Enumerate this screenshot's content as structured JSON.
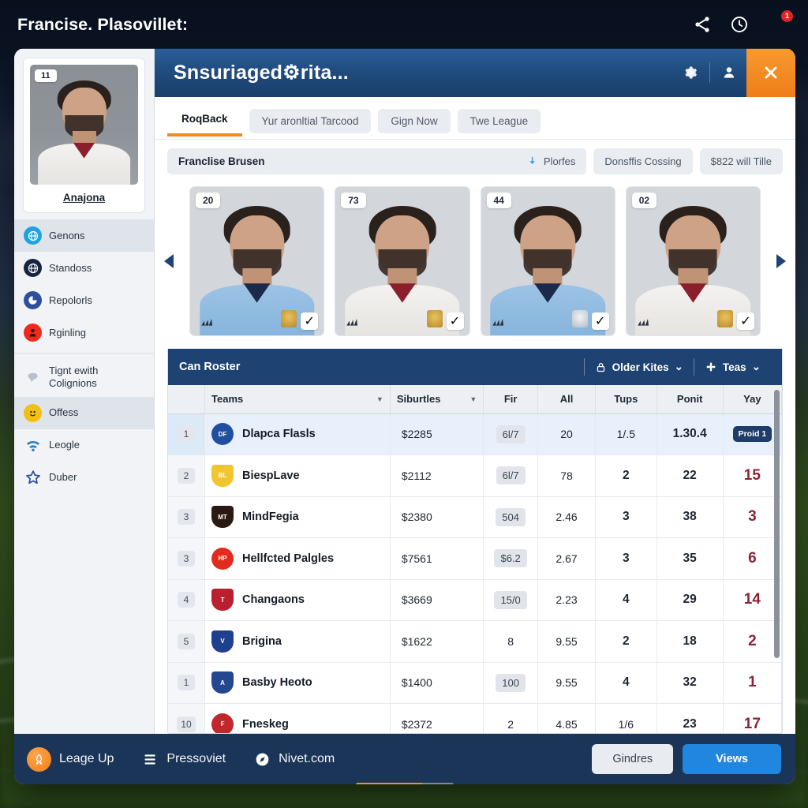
{
  "topbar": {
    "title": "Francise. Plasovillet:",
    "icons": [
      "share-icon",
      "clock-icon"
    ],
    "avatar_badge": "1"
  },
  "window": {
    "title": "Snsuriaged⚙rita...",
    "controls": {
      "settings": "gear-icon",
      "account": "person-icon",
      "close": "✕"
    }
  },
  "sidebar": {
    "profile": {
      "number": "11",
      "name": "Anajona"
    },
    "items": [
      {
        "label": "Genons",
        "icon": "globe-icon",
        "color": "#1ca3e0",
        "active": true
      },
      {
        "label": "Standoss",
        "icon": "globe-icon",
        "color": "#16243f",
        "active": false
      },
      {
        "label": "Repolorls",
        "icon": "pie-icon",
        "color": "#2d4f9e",
        "active": false
      },
      {
        "label": "Rginling",
        "icon": "person-icon",
        "color": "#ef2a1c",
        "active": false
      },
      {
        "label": "Tignt ewith Colignions",
        "icon": "bird-icon",
        "color": "#c7ccd4",
        "active": false
      },
      {
        "label": "Offess",
        "icon": "emoji-icon",
        "color": "#f2c014",
        "active": true
      },
      {
        "label": "Leogle",
        "icon": "wifi-icon",
        "color": "#2d7fc1",
        "active": false
      },
      {
        "label": "Duber",
        "icon": "star-icon",
        "color": "#2d4f9e",
        "active": false
      }
    ]
  },
  "tabs": [
    {
      "label": "RoqBack",
      "active": true
    },
    {
      "label": "Yur aronltial Tarcood",
      "active": false
    },
    {
      "label": "Gign Now",
      "active": false
    },
    {
      "label": "Twe League",
      "active": false
    }
  ],
  "filters": {
    "primary": "Franclise Brusen",
    "primary_action": "Plorfes",
    "primary_action_icon": "download-icon",
    "chips": [
      "Donsffis Cossing",
      "$822 will Tille"
    ]
  },
  "carousel": {
    "prev_icon": "chevron-left-icon",
    "next_icon": "chevron-right-icon",
    "cards": [
      {
        "number": "20",
        "kit": "kit-blue kit-navy",
        "crest": "gold",
        "check": "✓"
      },
      {
        "number": "73",
        "kit": "kit-white kit-red",
        "crest": "gold",
        "check": "✓"
      },
      {
        "number": "44",
        "kit": "kit-blue kit-navy",
        "crest": "silver",
        "check": "✓"
      },
      {
        "number": "02",
        "kit": "kit-white kit-red",
        "crest": "gold",
        "check": "✓"
      }
    ]
  },
  "roster": {
    "title": "Can Roster",
    "actions": [
      {
        "label": "Older Kites",
        "icon": "lock-icon",
        "caret": "⌄"
      },
      {
        "label": "Teas",
        "icon": "plus-icon",
        "caret": "⌄"
      }
    ],
    "columns": [
      {
        "key": "rank",
        "label": "",
        "align": "c",
        "sortable": false
      },
      {
        "key": "team",
        "label": "Teams",
        "align": "l",
        "sortable": true
      },
      {
        "key": "sal",
        "label": "Siburtles",
        "align": "l",
        "sortable": true
      },
      {
        "key": "fir",
        "label": "Fir",
        "align": "c",
        "sortable": false
      },
      {
        "key": "all",
        "label": "All",
        "align": "c",
        "sortable": false
      },
      {
        "key": "tups",
        "label": "Tups",
        "align": "c",
        "sortable": false
      },
      {
        "key": "pont",
        "label": "Ponit",
        "align": "c",
        "sortable": false
      },
      {
        "key": "yay",
        "label": "Yay",
        "align": "c",
        "sortable": false
      }
    ],
    "rows": [
      {
        "rank": "1",
        "team": "Dlapca Flasls",
        "logo": "#1f4f9e",
        "logo_shape": "circle",
        "logo_text": "DF",
        "sal": "$2285",
        "fir": "6l/7",
        "fir_pill": true,
        "all": "20",
        "tups": "1/.5",
        "tups_bold": false,
        "pont": "1.30.4",
        "yay": "Proid 1",
        "yay_badge": true,
        "selected": true
      },
      {
        "rank": "2",
        "team": "BiespLave",
        "logo": "#f0c52e",
        "logo_shape": "shield",
        "logo_text": "BL",
        "sal": "$2112",
        "fir": "6l/7",
        "fir_pill": true,
        "all": "78",
        "tups": "2",
        "tups_bold": true,
        "pont": "22",
        "yay": "15",
        "yay_badge": false,
        "selected": false
      },
      {
        "rank": "3",
        "team": "MindFegia",
        "logo": "#2b1a14",
        "logo_shape": "shield",
        "logo_text": "MT",
        "sal": "$2380",
        "fir": "504",
        "fir_pill": true,
        "all": "2.46",
        "tups": "3",
        "tups_bold": true,
        "pont": "38",
        "yay": "3",
        "yay_badge": false,
        "selected": false
      },
      {
        "rank": "3",
        "team": "Hellfcted Palgles",
        "logo": "#e22b1e",
        "logo_shape": "circle",
        "logo_text": "HP",
        "sal": "$7561",
        "fir": "$6.2",
        "fir_pill": true,
        "all": "2.67",
        "tups": "3",
        "tups_bold": true,
        "pont": "35",
        "yay": "6",
        "yay_badge": false,
        "selected": false
      },
      {
        "rank": "4",
        "team": "Changaons",
        "logo": "#b9202f",
        "logo_shape": "shield",
        "logo_text": "T",
        "sal": "$3669",
        "fir": "15/0",
        "fir_pill": true,
        "all": "2.23",
        "tups": "4",
        "tups_bold": true,
        "pont": "29",
        "yay": "14",
        "yay_badge": false,
        "selected": false
      },
      {
        "rank": "5",
        "team": "Brigina",
        "logo": "#1f3f8f",
        "logo_shape": "shield",
        "logo_text": "V",
        "sal": "$1622",
        "fir": "8",
        "fir_pill": false,
        "all": "9.55",
        "tups": "2",
        "tups_bold": true,
        "pont": "18",
        "yay": "2",
        "yay_badge": false,
        "selected": false
      },
      {
        "rank": "1",
        "team": "Basby Heoto",
        "logo": "#24478f",
        "logo_shape": "shield",
        "logo_text": "A",
        "sal": "$1400",
        "fir": "100",
        "fir_pill": true,
        "all": "9.55",
        "tups": "4",
        "tups_bold": true,
        "pont": "32",
        "yay": "1",
        "yay_badge": false,
        "selected": false
      },
      {
        "rank": "10",
        "team": "Fneskeg",
        "logo": "#c1272d",
        "logo_shape": "circle",
        "logo_text": "F",
        "sal": "$2372",
        "fir": "2",
        "fir_pill": false,
        "all": "4.85",
        "tups": "1/6",
        "tups_bold": false,
        "pont": "23",
        "yay": "17",
        "yay_badge": false,
        "selected": false
      }
    ]
  },
  "bottombar": {
    "items": [
      {
        "label": "Leage Up",
        "icon": "rocket-icon"
      },
      {
        "label": "Pressoviet",
        "icon": "list-icon"
      },
      {
        "label": "Nivet.com",
        "icon": "compass-icon"
      }
    ],
    "buttons": [
      {
        "label": "Gindres",
        "style": "light"
      },
      {
        "label": "Views",
        "style": "blue"
      }
    ]
  }
}
